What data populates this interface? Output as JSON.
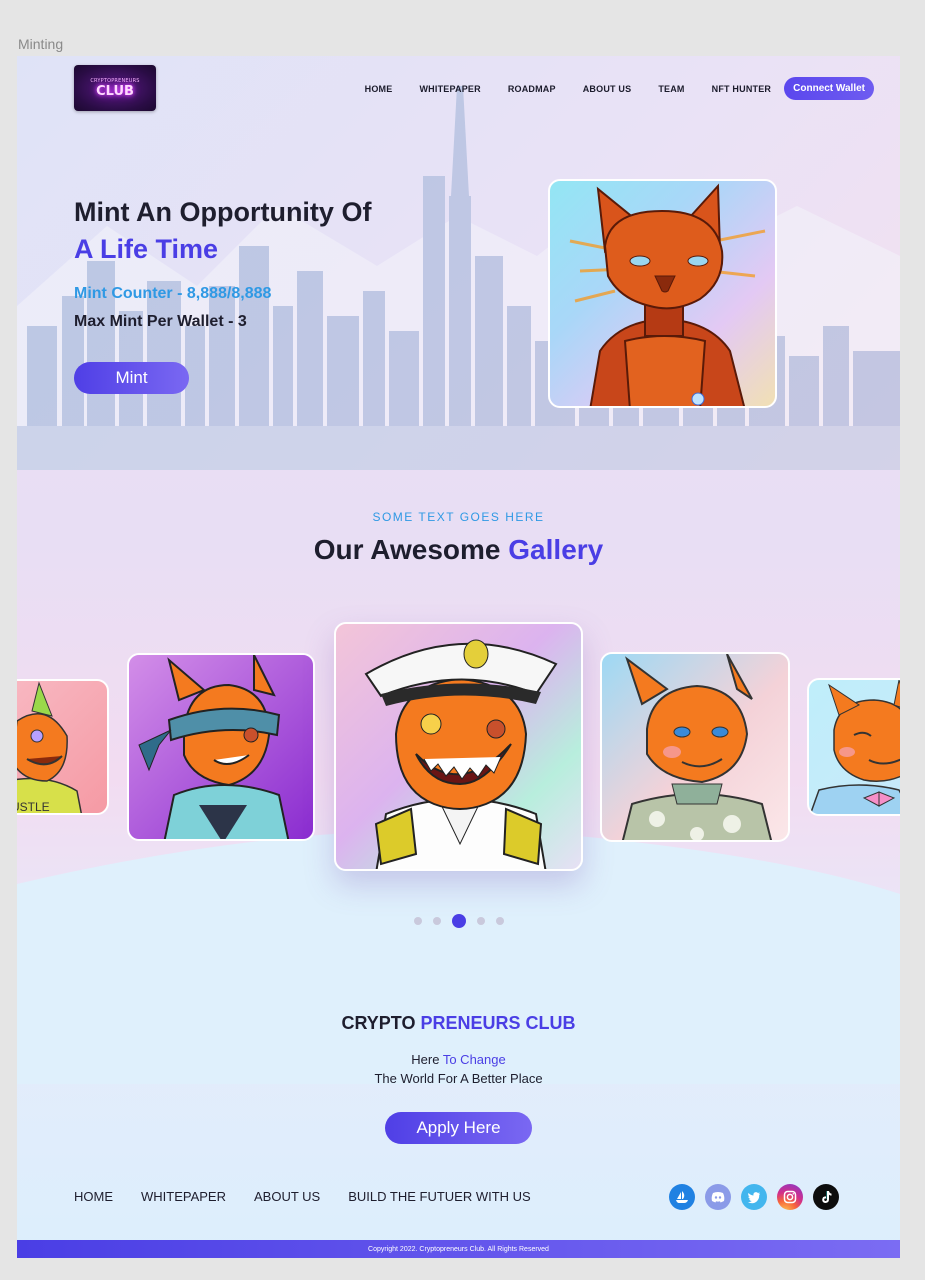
{
  "frame_label": "Minting",
  "logo": {
    "top_text": "CRYPTOPRENEURS",
    "main_text": "CLUB"
  },
  "nav": {
    "items": [
      "HOME",
      "WHITEPAPER",
      "ROADMAP",
      "ABOUT US",
      "TEAM",
      "NFT HUNTER"
    ],
    "wallet_button": "Connect Wallet"
  },
  "hero": {
    "title_line1": "Mint An Opportunity Of",
    "title_line2": "A Life Time",
    "counter": "Mint Counter - 8,888/8,888",
    "max_mint": "Max Mint Per Wallet - 3",
    "mint_button": "Mint"
  },
  "gallery": {
    "subtitle": "SOME TEXT GOES HERE",
    "title_plain": "Our Awesome",
    "title_accent": "Gallery",
    "card1_shirt_text": "USTLE",
    "pagination": {
      "count": 5,
      "active_index": 3
    }
  },
  "cta": {
    "club_plain": "CRYPTO",
    "club_accent": "PRENEURS CLUB",
    "tag_plain": "Here",
    "tag_accent": "To Change",
    "tag_line2": "The World For A Better Place",
    "apply_button": "Apply Here"
  },
  "footer": {
    "links": [
      "HOME",
      "WHITEPAPER",
      "ABOUT US",
      "BUILD THE FUTUER WITH US"
    ],
    "socials": [
      "opensea-icon",
      "discord-icon",
      "twitter-icon",
      "instagram-icon",
      "tiktok-icon"
    ],
    "copyright": "Copyright 2022. Cryptopreneurs Club. All Rights Reserved"
  },
  "colors": {
    "accent": "#4a3ee5",
    "secondary": "#2f99e4",
    "text": "#1e1e2e",
    "fox_orange": "#f47a1f"
  }
}
